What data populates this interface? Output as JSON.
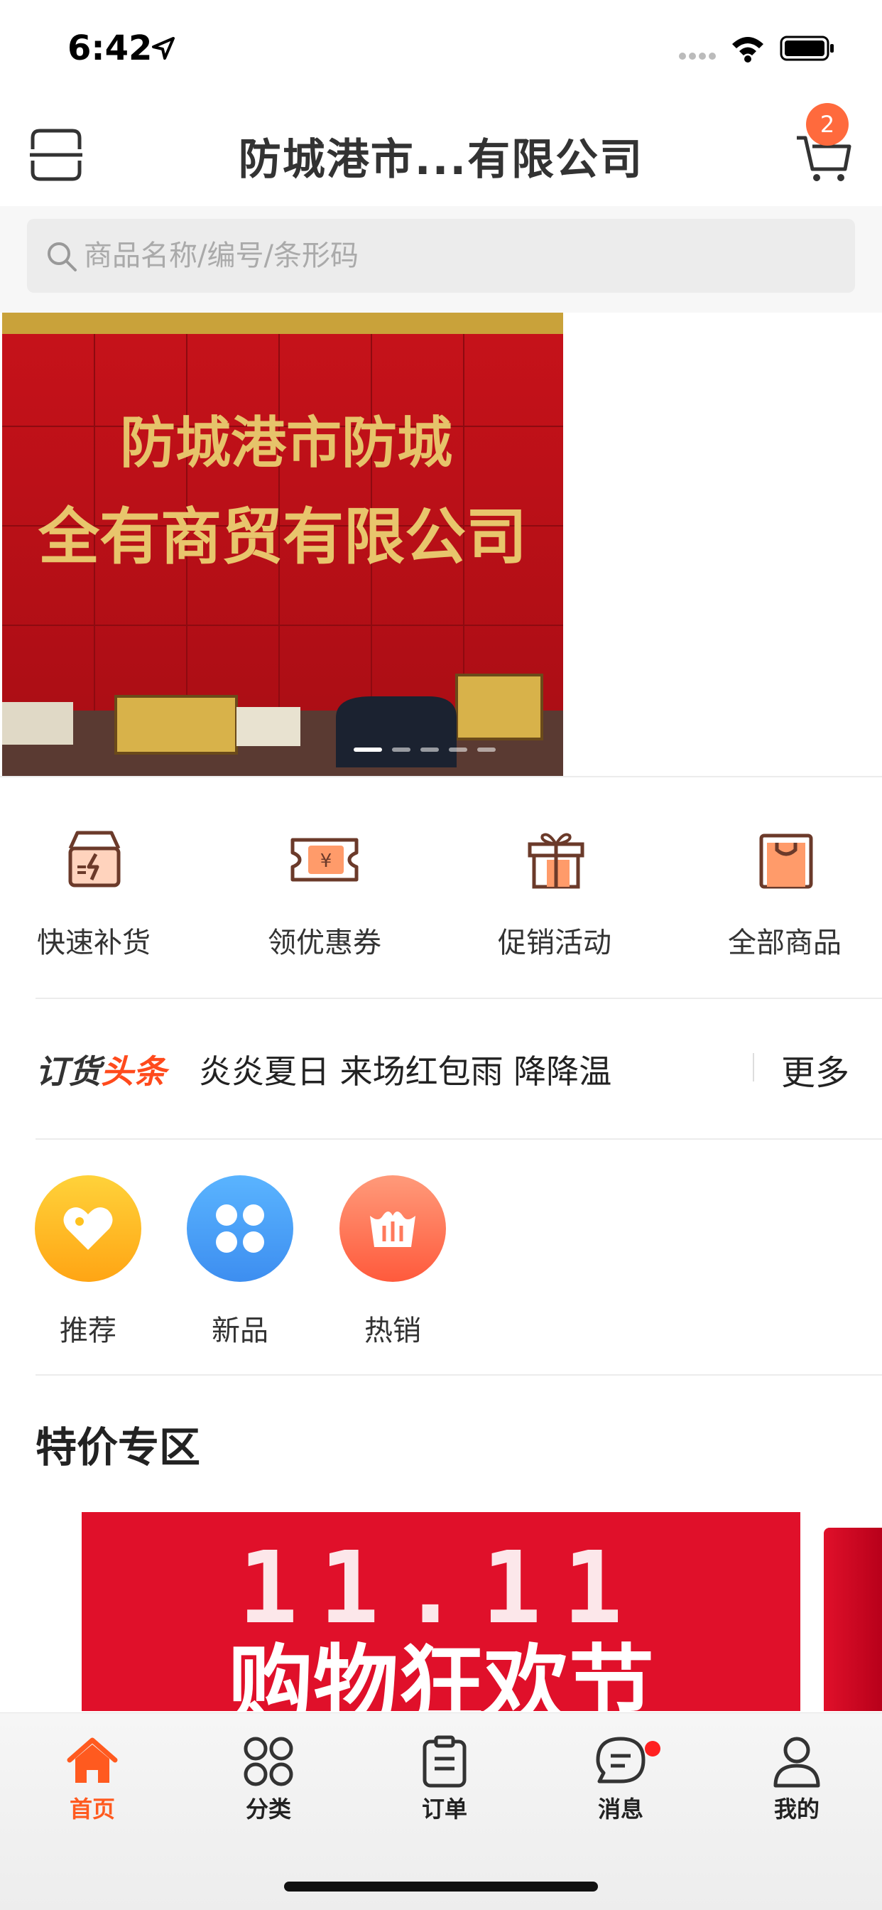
{
  "status_bar": {
    "time": "6:42"
  },
  "header": {
    "title": "防城港市...有限公司",
    "cart_count": "2"
  },
  "search": {
    "placeholder": "商品名称/编号/条形码"
  },
  "banner": {
    "sign_line1": "防城港市防城",
    "sign_line2": "全有商贸有限公司",
    "slide_count": 5,
    "active_slide": 1
  },
  "quick_menu": [
    {
      "label": "快速补货",
      "icon": "box-lightning-icon"
    },
    {
      "label": "领优惠券",
      "icon": "coupon-icon"
    },
    {
      "label": "促销活动",
      "icon": "gift-icon"
    },
    {
      "label": "全部商品",
      "icon": "shopping-bag-icon"
    }
  ],
  "headline": {
    "brand_part1": "订货",
    "brand_part2": "头条",
    "text": "炎炎夏日  来场红包雨 降降温",
    "more": "更多"
  },
  "categories": [
    {
      "label": "推荐",
      "icon": "heart-icon",
      "color": "#ffb21e"
    },
    {
      "label": "新品",
      "icon": "clover-icon",
      "color": "#4a9bf2"
    },
    {
      "label": "热销",
      "icon": "crown-icon",
      "color": "#ff7a5c"
    }
  ],
  "special": {
    "title": "特价专区",
    "promo_top": "11.11",
    "promo_bottom": "购物狂欢节"
  },
  "tabbar": [
    {
      "label": "首页",
      "icon": "home-icon",
      "active": true
    },
    {
      "label": "分类",
      "icon": "category-icon",
      "active": false
    },
    {
      "label": "订单",
      "icon": "clipboard-icon",
      "active": false
    },
    {
      "label": "消息",
      "icon": "message-icon",
      "active": false
    },
    {
      "label": "我的",
      "icon": "user-icon",
      "active": false
    }
  ],
  "colors": {
    "accent": "#ff5a1f",
    "badge": "#ff6a3d",
    "promo_red": "#e0102a"
  }
}
